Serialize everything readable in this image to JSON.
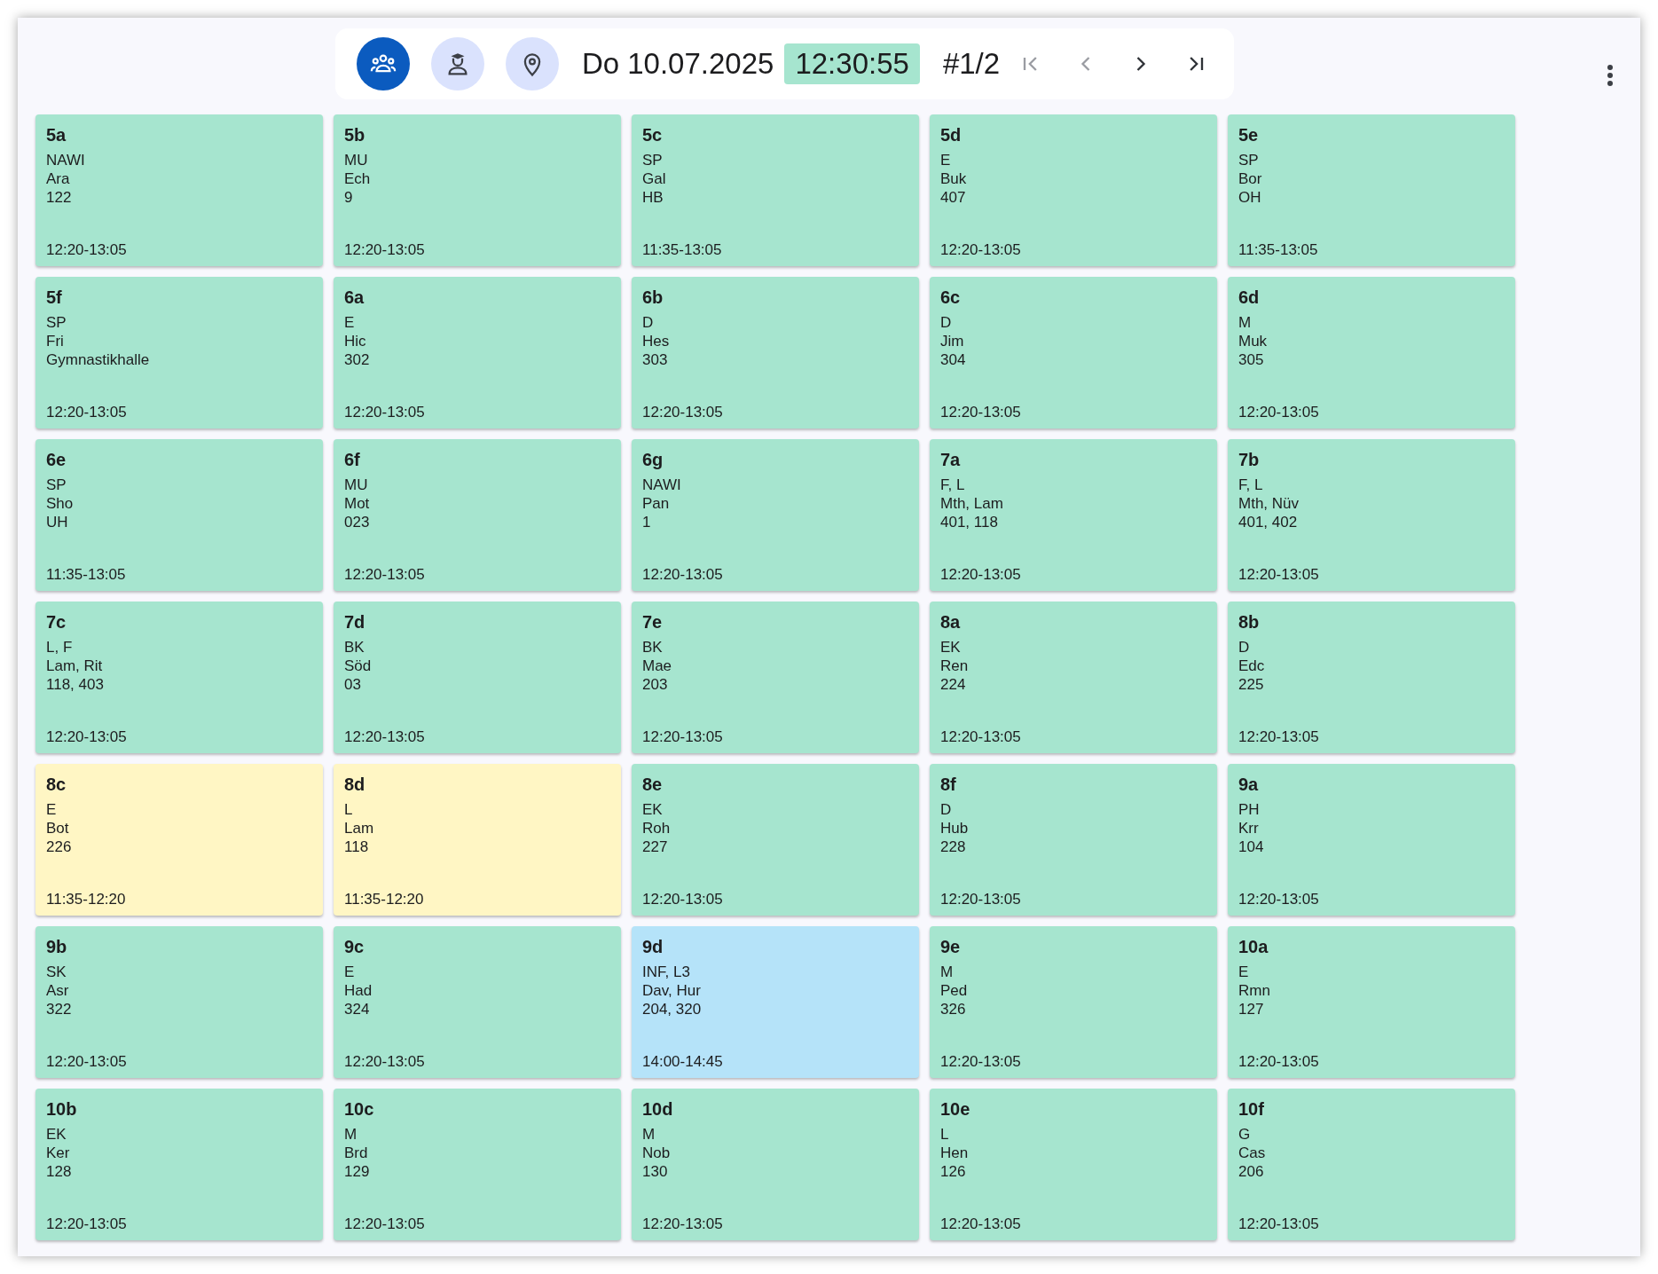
{
  "toolbar": {
    "modes": [
      {
        "kind": "classes",
        "selected": true
      },
      {
        "kind": "teachers",
        "selected": false
      },
      {
        "kind": "rooms",
        "selected": false
      }
    ],
    "date": "Do 10.07.2025",
    "time": "12:30:55",
    "page": "#1/2",
    "nav": [
      {
        "kind": "first",
        "disabled": true
      },
      {
        "kind": "prev",
        "disabled": true
      },
      {
        "kind": "next",
        "disabled": false
      },
      {
        "kind": "last",
        "disabled": false
      }
    ]
  },
  "cards": [
    {
      "class": "5a",
      "lines": [
        "NAWI",
        "Ara",
        "122"
      ],
      "time": "12:20-13:05",
      "color": "#a6e5cf"
    },
    {
      "class": "5b",
      "lines": [
        "MU",
        "Ech",
        "9"
      ],
      "time": "12:20-13:05",
      "color": "#a6e5cf"
    },
    {
      "class": "5c",
      "lines": [
        "SP",
        "Gal",
        "HB"
      ],
      "time": "11:35-13:05",
      "color": "#a6e5cf"
    },
    {
      "class": "5d",
      "lines": [
        "E",
        "Buk",
        "407"
      ],
      "time": "12:20-13:05",
      "color": "#a6e5cf"
    },
    {
      "class": "5e",
      "lines": [
        "SP",
        "Bor",
        "OH"
      ],
      "time": "11:35-13:05",
      "color": "#a6e5cf"
    },
    {
      "class": "5f",
      "lines": [
        "SP",
        "Fri",
        "Gymnastikhalle"
      ],
      "time": "12:20-13:05",
      "color": "#a6e5cf"
    },
    {
      "class": "6a",
      "lines": [
        "E",
        "Hic",
        "302"
      ],
      "time": "12:20-13:05",
      "color": "#a6e5cf"
    },
    {
      "class": "6b",
      "lines": [
        "D",
        "Hes",
        "303"
      ],
      "time": "12:20-13:05",
      "color": "#a6e5cf"
    },
    {
      "class": "6c",
      "lines": [
        "D",
        "Jim",
        "304"
      ],
      "time": "12:20-13:05",
      "color": "#a6e5cf"
    },
    {
      "class": "6d",
      "lines": [
        "M",
        "Muk",
        "305"
      ],
      "time": "12:20-13:05",
      "color": "#a6e5cf"
    },
    {
      "class": "6e",
      "lines": [
        "SP",
        "Sho",
        "UH"
      ],
      "time": "11:35-13:05",
      "color": "#a6e5cf"
    },
    {
      "class": "6f",
      "lines": [
        "MU",
        "Mot",
        "023"
      ],
      "time": "12:20-13:05",
      "color": "#a6e5cf"
    },
    {
      "class": "6g",
      "lines": [
        "NAWI",
        "Pan",
        "1"
      ],
      "time": "12:20-13:05",
      "color": "#a6e5cf"
    },
    {
      "class": "7a",
      "lines": [
        "F, L",
        "Mth, Lam",
        "401, 118"
      ],
      "time": "12:20-13:05",
      "color": "#a6e5cf"
    },
    {
      "class": "7b",
      "lines": [
        "F, L",
        "Mth, Nüv",
        "401, 402"
      ],
      "time": "12:20-13:05",
      "color": "#a6e5cf"
    },
    {
      "class": "7c",
      "lines": [
        "L, F",
        "Lam, Rit",
        "118, 403"
      ],
      "time": "12:20-13:05",
      "color": "#a6e5cf"
    },
    {
      "class": "7d",
      "lines": [
        "BK",
        "Söd",
        "03"
      ],
      "time": "12:20-13:05",
      "color": "#a6e5cf"
    },
    {
      "class": "7e",
      "lines": [
        "BK",
        "Mae",
        "203"
      ],
      "time": "12:20-13:05",
      "color": "#a6e5cf"
    },
    {
      "class": "8a",
      "lines": [
        "EK",
        "Ren",
        "224"
      ],
      "time": "12:20-13:05",
      "color": "#a6e5cf"
    },
    {
      "class": "8b",
      "lines": [
        "D",
        "Edc",
        "225"
      ],
      "time": "12:20-13:05",
      "color": "#a6e5cf"
    },
    {
      "class": "8c",
      "lines": [
        "E",
        "Bot",
        "226"
      ],
      "time": "11:35-12:20",
      "color": "#fff6c4"
    },
    {
      "class": "8d",
      "lines": [
        "L",
        "Lam",
        "118"
      ],
      "time": "11:35-12:20",
      "color": "#fff6c4"
    },
    {
      "class": "8e",
      "lines": [
        "EK",
        "Roh",
        "227"
      ],
      "time": "12:20-13:05",
      "color": "#a6e5cf"
    },
    {
      "class": "8f",
      "lines": [
        "D",
        "Hub",
        "228"
      ],
      "time": "12:20-13:05",
      "color": "#a6e5cf"
    },
    {
      "class": "9a",
      "lines": [
        "PH",
        "Krr",
        "104"
      ],
      "time": "12:20-13:05",
      "color": "#a6e5cf"
    },
    {
      "class": "9b",
      "lines": [
        "SK",
        "Asr",
        "322"
      ],
      "time": "12:20-13:05",
      "color": "#a6e5cf"
    },
    {
      "class": "9c",
      "lines": [
        "E",
        "Had",
        "324"
      ],
      "time": "12:20-13:05",
      "color": "#a6e5cf"
    },
    {
      "class": "9d",
      "lines": [
        "INF, L3",
        "Dav, Hur",
        "204, 320"
      ],
      "time": "14:00-14:45",
      "color": "#b5e3f9"
    },
    {
      "class": "9e",
      "lines": [
        "M",
        "Ped",
        "326"
      ],
      "time": "12:20-13:05",
      "color": "#a6e5cf"
    },
    {
      "class": "10a",
      "lines": [
        "E",
        "Rmn",
        "127"
      ],
      "time": "12:20-13:05",
      "color": "#a6e5cf"
    },
    {
      "class": "10b",
      "lines": [
        "EK",
        "Ker",
        "128"
      ],
      "time": "12:20-13:05",
      "color": "#a6e5cf"
    },
    {
      "class": "10c",
      "lines": [
        "M",
        "Brd",
        "129"
      ],
      "time": "12:20-13:05",
      "color": "#a6e5cf"
    },
    {
      "class": "10d",
      "lines": [
        "M",
        "Nob",
        "130"
      ],
      "time": "12:20-13:05",
      "color": "#a6e5cf"
    },
    {
      "class": "10e",
      "lines": [
        "L",
        "Hen",
        "126"
      ],
      "time": "12:20-13:05",
      "color": "#a6e5cf"
    },
    {
      "class": "10f",
      "lines": [
        "G",
        "Cas",
        "206"
      ],
      "time": "12:20-13:05",
      "color": "#a6e5cf"
    }
  ]
}
